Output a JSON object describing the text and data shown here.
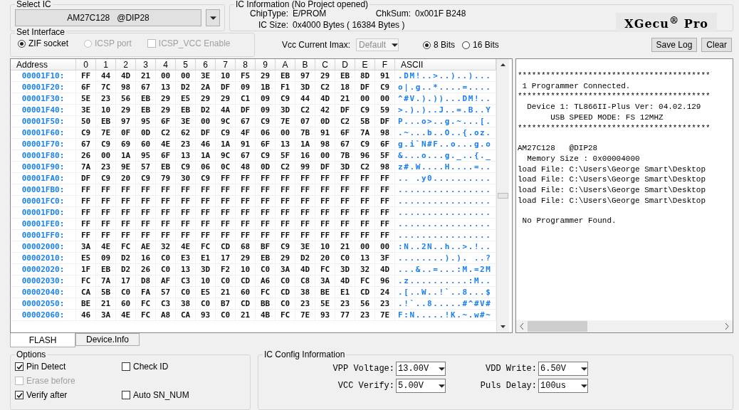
{
  "select_ic": {
    "legend": "Select IC",
    "value": "AM27C128   @DIP28"
  },
  "ic_info": {
    "legend": "IC Information (No Project opened)",
    "chip_type_label": "ChipType:",
    "chip_type": "E/PROM",
    "chksum_label": "ChkSum:",
    "chksum": "0x001F B248",
    "ic_size_label": "IC Size:",
    "ic_size": "0x4000 Bytes ( 16384 Bytes )",
    "logo": "XGecu$^{®}$ Pro"
  },
  "interface": {
    "legend": "Set Interface",
    "options": [
      {
        "kind": "radio",
        "label": "ZIF socket",
        "selected": true,
        "disabled": false
      },
      {
        "kind": "radio",
        "label": "ICSP port",
        "selected": false,
        "disabled": true
      },
      {
        "kind": "checkbox",
        "label": "ICSP_VCC Enable",
        "selected": false,
        "disabled": true
      }
    ]
  },
  "vcc_imax": {
    "label": "Vcc Current Imax:",
    "value": "Default",
    "disabled": true
  },
  "bits": [
    {
      "label": "8 Bits",
      "selected": true
    },
    {
      "label": "16 Bits",
      "selected": false
    }
  ],
  "buttons": [
    "Save Log",
    "Clear"
  ],
  "hex_table": {
    "columns": [
      "Address",
      "0",
      "1",
      "2",
      "3",
      "4",
      "5",
      "6",
      "7",
      "8",
      "9",
      "A",
      "B",
      "C",
      "D",
      "E",
      "F",
      "ASCII"
    ],
    "rows": [
      {
        "address": "00001F10:",
        "bytes": [
          "FF",
          "44",
          "4D",
          "21",
          "00",
          "00",
          "3E",
          "10",
          "F5",
          "29",
          "EB",
          "97",
          "29",
          "EB",
          "8D",
          "91"
        ],
        "ascii": ".DM!..>..)..)..."
      },
      {
        "address": "00001F20:",
        "bytes": [
          "6F",
          "7C",
          "98",
          "67",
          "13",
          "D2",
          "2A",
          "DF",
          "09",
          "1B",
          "F1",
          "3D",
          "C2",
          "18",
          "DF",
          "C9"
        ],
        "ascii": "o|.g..*....=...."
      },
      {
        "address": "00001F30:",
        "bytes": [
          "5E",
          "23",
          "56",
          "EB",
          "29",
          "E5",
          "29",
          "29",
          "C1",
          "09",
          "C9",
          "44",
          "4D",
          "21",
          "00",
          "00"
        ],
        "ascii": "^#V.).))...DM!.."
      },
      {
        "address": "00001F40:",
        "bytes": [
          "3E",
          "10",
          "29",
          "EB",
          "29",
          "EB",
          "D2",
          "4A",
          "DF",
          "09",
          "3D",
          "C2",
          "42",
          "DF",
          "C9",
          "59"
        ],
        "ascii": ">.).)..J..=.B..Y"
      },
      {
        "address": "00001F50:",
        "bytes": [
          "50",
          "EB",
          "97",
          "95",
          "6F",
          "3E",
          "00",
          "9C",
          "67",
          "C9",
          "7E",
          "07",
          "0D",
          "C2",
          "5B",
          "DF"
        ],
        "ascii": "P...o>..g.~...[."
      },
      {
        "address": "00001F60:",
        "bytes": [
          "C9",
          "7E",
          "0F",
          "0D",
          "C2",
          "62",
          "DF",
          "C9",
          "4F",
          "06",
          "00",
          "7B",
          "91",
          "6F",
          "7A",
          "98"
        ],
        "ascii": ".~...b..O..{.oz."
      },
      {
        "address": "00001F70:",
        "bytes": [
          "67",
          "C9",
          "69",
          "60",
          "4E",
          "23",
          "46",
          "1A",
          "91",
          "6F",
          "13",
          "1A",
          "98",
          "67",
          "C9",
          "6F"
        ],
        "ascii": "g.i`N#F..o...g.o"
      },
      {
        "address": "00001F80:",
        "bytes": [
          "26",
          "00",
          "1A",
          "95",
          "6F",
          "13",
          "1A",
          "9C",
          "67",
          "C9",
          "5F",
          "16",
          "00",
          "7B",
          "96",
          "5F"
        ],
        "ascii": "&...o...g._..{._"
      },
      {
        "address": "00001F90:",
        "bytes": [
          "7A",
          "23",
          "9E",
          "57",
          "EB",
          "C9",
          "06",
          "0C",
          "48",
          "0D",
          "C2",
          "99",
          "DF",
          "3D",
          "C2",
          "98"
        ],
        "ascii": "z#.W....H....=.."
      },
      {
        "address": "00001FA0:",
        "bytes": [
          "DF",
          "C9",
          "20",
          "C9",
          "79",
          "30",
          "C9",
          "FF",
          "FF",
          "FF",
          "FF",
          "FF",
          "FF",
          "FF",
          "FF",
          "FF"
        ],
        "ascii": ".. .y0.........."
      },
      {
        "address": "00001FB0:",
        "bytes": [
          "FF",
          "FF",
          "FF",
          "FF",
          "FF",
          "FF",
          "FF",
          "FF",
          "FF",
          "FF",
          "FF",
          "FF",
          "FF",
          "FF",
          "FF",
          "FF"
        ],
        "ascii": "................"
      },
      {
        "address": "00001FC0:",
        "bytes": [
          "FF",
          "FF",
          "FF",
          "FF",
          "FF",
          "FF",
          "FF",
          "FF",
          "FF",
          "FF",
          "FF",
          "FF",
          "FF",
          "FF",
          "FF",
          "FF"
        ],
        "ascii": "................"
      },
      {
        "address": "00001FD0:",
        "bytes": [
          "FF",
          "FF",
          "FF",
          "FF",
          "FF",
          "FF",
          "FF",
          "FF",
          "FF",
          "FF",
          "FF",
          "FF",
          "FF",
          "FF",
          "FF",
          "FF"
        ],
        "ascii": "................"
      },
      {
        "address": "00001FE0:",
        "bytes": [
          "FF",
          "FF",
          "FF",
          "FF",
          "FF",
          "FF",
          "FF",
          "FF",
          "FF",
          "FF",
          "FF",
          "FF",
          "FF",
          "FF",
          "FF",
          "FF"
        ],
        "ascii": "................"
      },
      {
        "address": "00001FF0:",
        "bytes": [
          "FF",
          "FF",
          "FF",
          "FF",
          "FF",
          "FF",
          "FF",
          "FF",
          "FF",
          "FF",
          "FF",
          "FF",
          "FF",
          "FF",
          "FF",
          "FF"
        ],
        "ascii": "................"
      },
      {
        "address": "00002000:",
        "bytes": [
          "3A",
          "4E",
          "FC",
          "AE",
          "32",
          "4E",
          "FC",
          "CD",
          "68",
          "BF",
          "C9",
          "3E",
          "10",
          "21",
          "00",
          "00"
        ],
        "ascii": ":N..2N..h..>.!.."
      },
      {
        "address": "00002010:",
        "bytes": [
          "E5",
          "09",
          "D2",
          "16",
          "C0",
          "E3",
          "E1",
          "17",
          "29",
          "EB",
          "29",
          "D2",
          "20",
          "C0",
          "13",
          "3F"
        ],
        "ascii": "........).). ..?"
      },
      {
        "address": "00002020:",
        "bytes": [
          "1F",
          "EB",
          "D2",
          "26",
          "C0",
          "13",
          "3D",
          "F2",
          "10",
          "C0",
          "3A",
          "4D",
          "FC",
          "3D",
          "32",
          "4D"
        ],
        "ascii": "...&..=...:M.=2M"
      },
      {
        "address": "00002030:",
        "bytes": [
          "FC",
          "7A",
          "17",
          "D8",
          "AF",
          "C3",
          "10",
          "C0",
          "CD",
          "A6",
          "C0",
          "C8",
          "3A",
          "4D",
          "FC",
          "96"
        ],
        "ascii": ".z..........:M.."
      },
      {
        "address": "00002040:",
        "bytes": [
          "CA",
          "5B",
          "C0",
          "FA",
          "57",
          "C0",
          "E5",
          "21",
          "60",
          "FC",
          "CD",
          "38",
          "BE",
          "E1",
          "CD",
          "24"
        ],
        "ascii": ".[..W..!`..8...$"
      },
      {
        "address": "00002050:",
        "bytes": [
          "BE",
          "21",
          "60",
          "FC",
          "C3",
          "38",
          "C0",
          "B7",
          "CD",
          "BB",
          "C0",
          "23",
          "5E",
          "23",
          "56",
          "23"
        ],
        "ascii": ".!`..8.....#^#V#"
      },
      {
        "address": "00002060:",
        "bytes": [
          "46",
          "3A",
          "4E",
          "FC",
          "A8",
          "CA",
          "93",
          "C0",
          "21",
          "4B",
          "FC",
          "7E",
          "93",
          "77",
          "23",
          "7E"
        ],
        "ascii": "F:N.....!K.~.w#~"
      }
    ]
  },
  "log": [
    [
      "*****************************************",
      " 1 Programmer Connected.",
      "*****************************************",
      "  Device 1: TL866II-Plus Ver: 04.02.129",
      "       USB SPEED MODE: FS 12MHZ",
      "*****************************************"
    ],
    [
      "AM27C128   @DIP28",
      "  Memory Size : 0x00004000",
      "load File: C:\\Users\\George Smart\\Desktop",
      "load File: C:\\Users\\George Smart\\Desktop",
      "load File: C:\\Users\\George Smart\\Desktop",
      "load File: C:\\Users\\George Smart\\Desktop"
    ],
    [
      " No Programmer Found."
    ]
  ],
  "tabs": [
    {
      "label": "FLASH",
      "selected": true
    },
    {
      "label": "Device.Info",
      "selected": false
    }
  ],
  "options": {
    "legend": "Options",
    "rows": [
      [
        {
          "label": "Pin Detect",
          "checked": true,
          "disabled": false
        },
        {
          "label": "Check ID",
          "checked": false,
          "disabled": false
        }
      ],
      [
        {
          "label": "Erase before",
          "checked": false,
          "disabled": true
        }
      ],
      [
        {
          "label": "Verify after",
          "checked": true,
          "disabled": false
        },
        {
          "label": "Auto SN_NUM",
          "checked": false,
          "disabled": false
        }
      ]
    ]
  },
  "ic_config": {
    "legend": "IC Config Information",
    "rows": [
      [
        {
          "label": "VPP Voltage:",
          "value": "13.00V"
        },
        {
          "label": "VDD Write:",
          "value": "6.50V"
        }
      ],
      [
        {
          "label": "VCC Verify:",
          "value": "5.00V"
        },
        {
          "label": "Puls Delay:",
          "value": "100us"
        }
      ]
    ]
  }
}
